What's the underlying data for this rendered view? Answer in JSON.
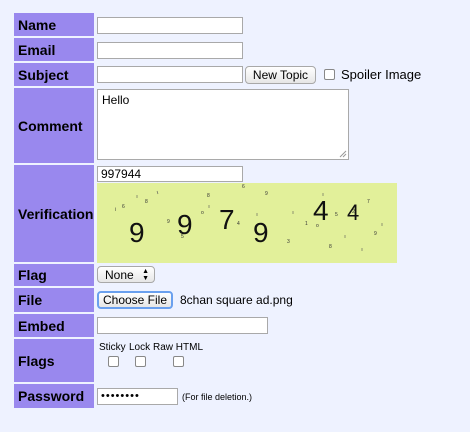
{
  "labels": {
    "name": "Name",
    "email": "Email",
    "subject": "Subject",
    "comment": "Comment",
    "verification": "Verification",
    "flag": "Flag",
    "file": "File",
    "embed": "Embed",
    "flags": "Flags",
    "password": "Password"
  },
  "fields": {
    "name_value": "",
    "email_value": "",
    "subject_value": "",
    "comment_value": "Hello",
    "verification_value": "997944",
    "embed_value": "",
    "password_value": "••••••••"
  },
  "buttons": {
    "new_topic": "New Topic",
    "choose_file": "Choose File"
  },
  "spoiler_label": "Spoiler Image",
  "captcha_chars": [
    "9",
    "9",
    "7",
    "9",
    "4",
    "4"
  ],
  "flag_select": {
    "selected": "None"
  },
  "file_name": "8chan square ad.png",
  "flag_options": [
    "Sticky",
    "Lock",
    "Raw HTML"
  ],
  "password_hint": "(For file deletion.)",
  "colors": {
    "label_bg": "#9988ee",
    "page_bg": "#eef2ff",
    "captcha_bg": "#e2f09a"
  }
}
